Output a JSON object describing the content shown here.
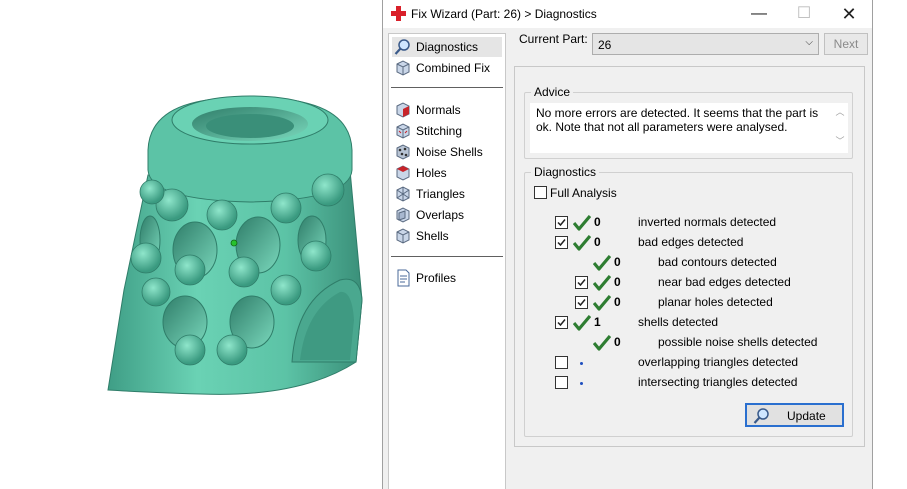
{
  "window": {
    "title": "Fix Wizard (Part: 26) > Diagnostics",
    "controls": [
      "minimize",
      "maximize",
      "close"
    ],
    "minimize_glyph": "—",
    "maximize_glyph": "☐",
    "close_glyph": "✕"
  },
  "nav": {
    "top_items": [
      {
        "label": "Diagnostics",
        "icon": "magnifier-icon",
        "active": true
      },
      {
        "label": "Combined Fix",
        "icon": "cube-icon"
      }
    ],
    "fix_items": [
      {
        "label": "Normals",
        "icon": "normals-cube-icon"
      },
      {
        "label": "Stitching",
        "icon": "stitching-cube-icon"
      },
      {
        "label": "Noise Shells",
        "icon": "noise-shells-icon"
      },
      {
        "label": "Holes",
        "icon": "holes-cube-icon"
      },
      {
        "label": "Triangles",
        "icon": "triangles-cube-icon"
      },
      {
        "label": "Overlaps",
        "icon": "overlaps-cube-icon"
      },
      {
        "label": "Shells",
        "icon": "shells-cube-icon"
      }
    ],
    "bottom_items": [
      {
        "label": "Profiles",
        "icon": "profiles-document-icon"
      }
    ]
  },
  "current_part": {
    "label": "Current Part:",
    "value": "26",
    "next_label": "Next"
  },
  "advice": {
    "title": "Advice",
    "text": "No more errors are detected. It seems that the part is ok. Note that not all parameters were analysed.",
    "scroll_up": "︿",
    "scroll_down": "﹀"
  },
  "diagnostics": {
    "title": "Diagnostics",
    "full_analysis_label": "Full Analysis",
    "full_analysis_checked": false,
    "rows": [
      {
        "checked": true,
        "status": "ok",
        "count": "0",
        "label": "inverted normals detected",
        "indent": 0
      },
      {
        "checked": true,
        "status": "ok",
        "count": "0",
        "label": "bad edges detected",
        "indent": 0
      },
      {
        "checked": null,
        "status": "ok",
        "count": "0",
        "label": "bad contours detected",
        "indent": 1
      },
      {
        "checked": true,
        "status": "ok",
        "count": "0",
        "label": "near bad edges detected",
        "indent": 1
      },
      {
        "checked": true,
        "status": "ok",
        "count": "0",
        "label": "planar holes detected",
        "indent": 1
      },
      {
        "checked": true,
        "status": "ok",
        "count": "1",
        "label": "shells detected",
        "indent": 0
      },
      {
        "checked": null,
        "status": "ok",
        "count": "0",
        "label": "possible noise shells detected",
        "indent": 1
      },
      {
        "checked": false,
        "status": "pending",
        "count": "",
        "label": "overlapping triangles detected",
        "indent": 0
      },
      {
        "checked": false,
        "status": "pending",
        "count": "",
        "label": "intersecting triangles detected",
        "indent": 0
      }
    ],
    "update_label": "Update"
  },
  "colors": {
    "model": "#5fc6a8",
    "tick": "#2e7d32",
    "accent": "#2a6fcf"
  }
}
